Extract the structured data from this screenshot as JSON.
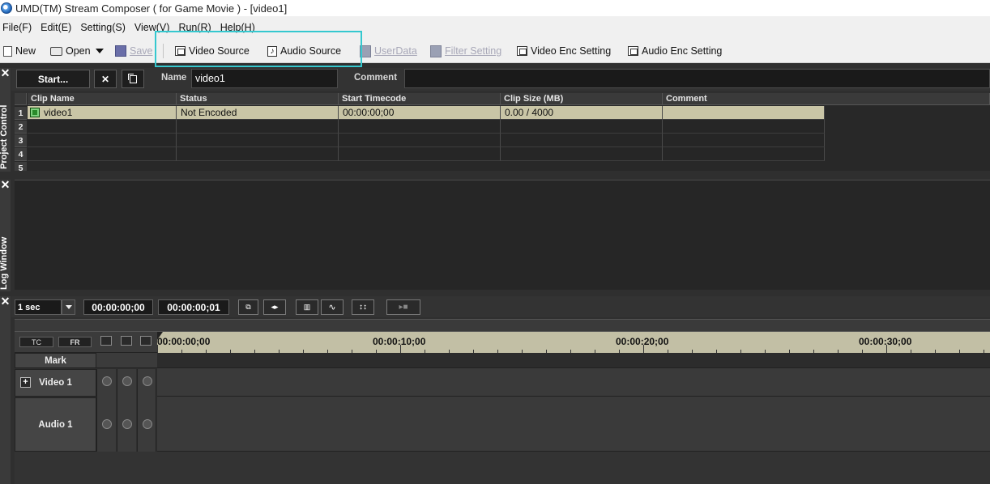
{
  "window": {
    "title": "UMD(TM) Stream Composer ( for Game Movie ) - [video1]"
  },
  "menu": [
    "File(F)",
    "Edit(E)",
    "Setting(S)",
    "View(V)",
    "Run(R)",
    "Help(H)"
  ],
  "toolbar": {
    "new": "New",
    "open": "Open",
    "save": "Save",
    "video_source": "Video Source",
    "audio_source": "Audio Source",
    "user_data": "UserData",
    "filter_setting": "Filter Setting",
    "video_enc": "Video Enc Setting",
    "audio_enc": "Audio Enc Setting"
  },
  "project": {
    "panel_label": "Project Control",
    "start_label": "Start...",
    "close_glyph": "✕",
    "name_label": "Name",
    "name_value": "video1",
    "comment_label": "Comment",
    "comment_value": "",
    "columns": [
      "Clip Name",
      "Status",
      "Start Timecode",
      "Clip Size (MB)",
      "Comment"
    ],
    "rows": [
      "1",
      "2",
      "3",
      "4",
      "5"
    ],
    "clip": {
      "name": "video1",
      "status": "Not Encoded",
      "start": "00:00:00;00",
      "size": "0.00 / 4000",
      "comment": ""
    }
  },
  "log": {
    "panel_label": "Log Window"
  },
  "timeline": {
    "scale": "1 sec",
    "time_a": "00:00:00;00",
    "time_b": "00:00:00;01",
    "tc_label": "TC",
    "fr_label": "FR",
    "mark_label": "Mark",
    "ruler": [
      "00:00:00;00",
      "00:00:10;00",
      "00:00:20;00",
      "00:00:30;00"
    ],
    "tracks": [
      "Video 1",
      "Audio 1"
    ],
    "plus": "+"
  },
  "colors": {
    "highlight": "#35c8cf",
    "selected_row": "#c9c5a6",
    "ruler": "#c2bfa5"
  }
}
